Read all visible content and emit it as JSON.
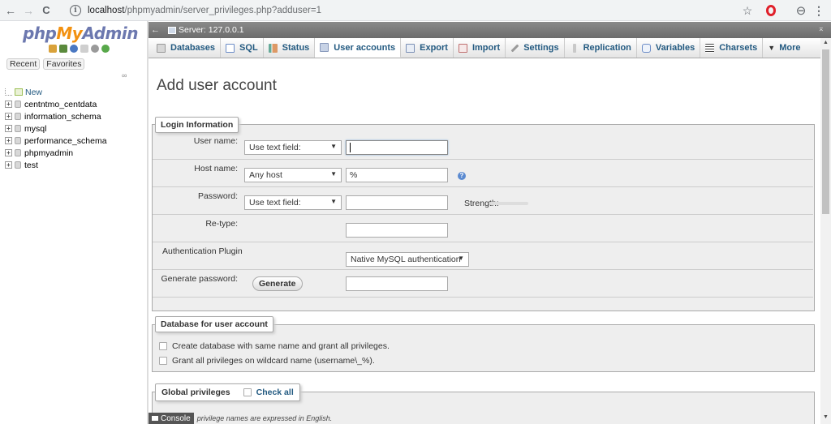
{
  "browser": {
    "back": "←",
    "forward": "→",
    "reload": "C",
    "url_host": "localhost",
    "url_path": "/phpmyadmin/server_privileges.php?adduser=1",
    "star": "☆",
    "profile": "⊖",
    "menu": "⋮"
  },
  "sidebar": {
    "logo": {
      "php": "php",
      "my": "My",
      "admin": "Admin"
    },
    "recent_label": "Recent",
    "favorites_label": "Favorites",
    "tree": [
      {
        "label": "New",
        "kind": "new"
      },
      {
        "label": "centntmo_centdata",
        "kind": "db"
      },
      {
        "label": "information_schema",
        "kind": "db"
      },
      {
        "label": "mysql",
        "kind": "db"
      },
      {
        "label": "performance_schema",
        "kind": "db"
      },
      {
        "label": "phpmyadmin",
        "kind": "db"
      },
      {
        "label": "test",
        "kind": "db"
      }
    ]
  },
  "serverbar": {
    "label": "Server: 127.0.0.1"
  },
  "tabs": [
    {
      "label": "Databases",
      "icon": "database-icon"
    },
    {
      "label": "SQL",
      "icon": "sql-icon"
    },
    {
      "label": "Status",
      "icon": "status-icon"
    },
    {
      "label": "User accounts",
      "icon": "users-icon",
      "active": true
    },
    {
      "label": "Export",
      "icon": "export-icon"
    },
    {
      "label": "Import",
      "icon": "import-icon"
    },
    {
      "label": "Settings",
      "icon": "wrench-icon"
    },
    {
      "label": "Replication",
      "icon": "replication-icon"
    },
    {
      "label": "Variables",
      "icon": "variables-icon"
    },
    {
      "label": "Charsets",
      "icon": "charsets-icon"
    },
    {
      "label": "More",
      "icon": "caret-down-icon"
    }
  ],
  "page": {
    "title": "Add user account"
  },
  "login": {
    "legend": "Login Information",
    "username_label": "User name:",
    "username_mode": "Use text field:",
    "username_value": "",
    "host_label": "Host name:",
    "host_mode": "Any host",
    "host_value": "%",
    "password_label": "Password:",
    "password_mode": "Use text field:",
    "password_value": "",
    "strength_label": "Strength:",
    "retype_label": "Re-type:",
    "retype_value": "",
    "auth_label": "Authentication Plugin",
    "auth_value": "Native MySQL authentication",
    "generate_label": "Generate password:",
    "generate_button": "Generate",
    "generated_value": ""
  },
  "database": {
    "legend": "Database for user account",
    "option1": "Create database with same name and grant all privileges.",
    "option2": "Grant all privileges on wildcard name (username\\_%)."
  },
  "global": {
    "legend": "Global privileges",
    "check_all": "Check all"
  },
  "console": {
    "button": "Console",
    "note": "privilege names are expressed in English."
  },
  "colors": {
    "logo_blue": "#6c78af",
    "logo_orange": "#f29111",
    "link": "#235a81"
  }
}
